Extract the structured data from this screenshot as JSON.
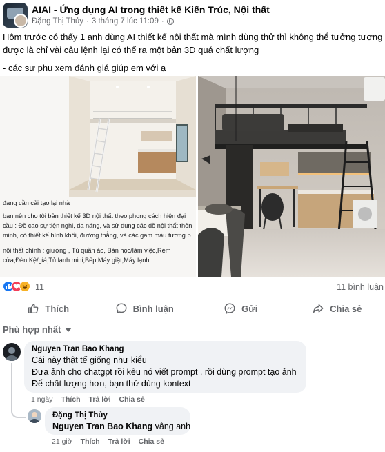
{
  "post": {
    "group_name": "AIAI - Ứng dụng AI trong thiết kế Kiến Trúc, Nội thất",
    "author": "Đặng Thị Thủy",
    "time": "3 tháng 7 lúc 11:09",
    "separator": "·",
    "text_lines": [
      "Hôm trước có thấy 1 anh dùng AI thiết kế nội thất mà mình dùng thử thì không thể tưởng tượng được là chỉ vài câu lệnh lại có thể ra một bản 3D quá chất lượng",
      "- các sư phụ xem đánh giá giúp em với ạ"
    ]
  },
  "photos": {
    "caption_title": "đang cần cải tạo lại nhà",
    "caption_body": [
      "bạn nên cho tôi bản thiết kế 3D nội thất theo phong cách hiện đại",
      "cầu : Đề cao sự tiện nghi, đa năng, và sử dụng các đồ nội thất thôn",
      "minh, có thiết kế hình khối, đường thẳng, và các gam màu tương p"
    ],
    "caption_list": [
      "nội thất chính : giường , Tủ quần áo, Bàn học/làm việc,Rèm",
      "cửa,Đèn,Kệ/giá,Tủ lạnh mini,Bếp,Máy giặt,Máy lạnh"
    ]
  },
  "stats": {
    "reaction_count": "11",
    "comment_count": "11 bình luận",
    "reactions": [
      "like-icon",
      "love-icon",
      "haha-icon"
    ]
  },
  "actions": {
    "like": "Thích",
    "comment": "Bình luận",
    "send": "Gửi",
    "share": "Chia sẻ"
  },
  "sort": {
    "label": "Phù hợp nhất"
  },
  "comments": [
    {
      "author": "Nguyen Tran Bao Khang",
      "lines": [
        "Cái này thật tế giống như kiểu",
        "Đưa ảnh cho chatgpt rồi kêu nó viết prompt , rồi dùng prompt tạo ảnh",
        "Để chất lượng hơn, bạn thử dùng kontext"
      ],
      "time": "1 ngày",
      "like": "Thích",
      "reply": "Trả lời",
      "share": "Chia sẻ"
    },
    {
      "author": "Đặng Thị Thủy",
      "mention": "Nguyen Tran Bao Khang",
      "text": " vâng anh",
      "time": "21 giờ",
      "like": "Thích",
      "reply": "Trả lời",
      "share": "Chia sẻ"
    }
  ],
  "colors": {
    "accent": "#1877f2",
    "text_secondary": "#65676b",
    "bubble": "#f0f2f5"
  }
}
